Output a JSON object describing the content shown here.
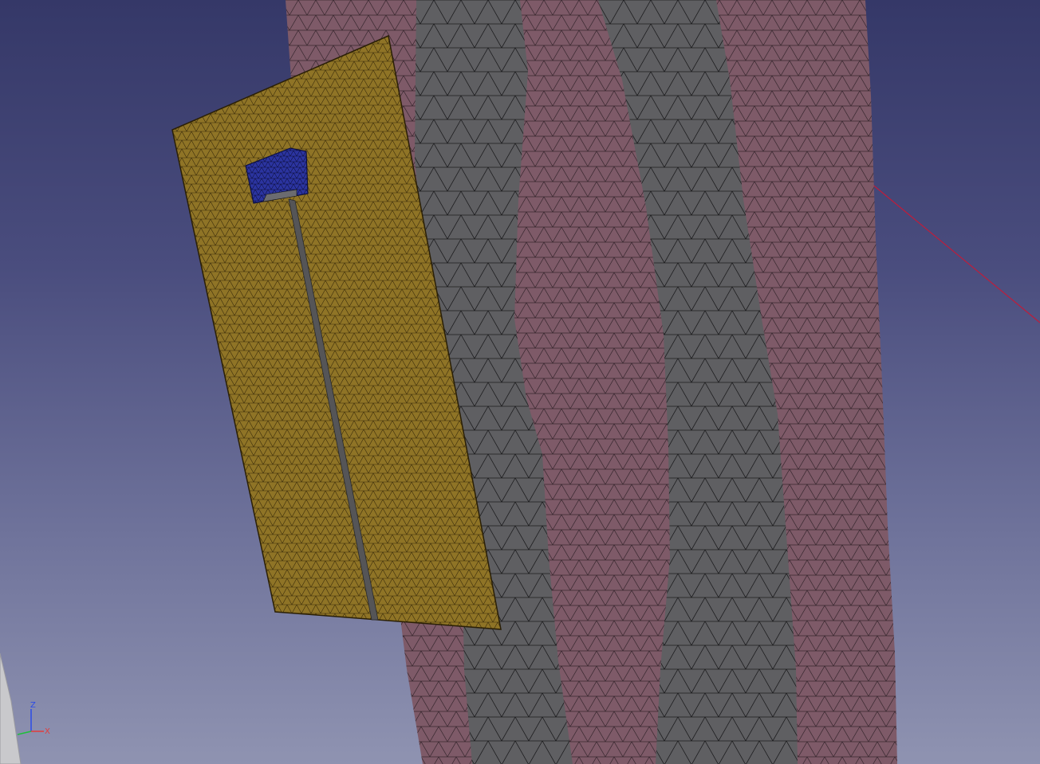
{
  "app": {
    "view": "3D viewport"
  },
  "scene": {
    "background_top": "#353868",
    "background_bottom": "#8f93b1",
    "tissue_color": "#7e5a68",
    "tissue_edge_color": "#c2a3ae",
    "band_color": "#5f5f62",
    "board_color": "#8f7426",
    "board_edge_color": "#6a5418",
    "chip_color": "#2b34a0",
    "wire_color": "#555557",
    "axis_line_color": "#c01c3a"
  },
  "axis_triad": {
    "z_label": "Z",
    "x_label": "X",
    "x_color": "#e23b3b",
    "y_color": "#1fbf3a",
    "z_color": "#2b4be8"
  }
}
